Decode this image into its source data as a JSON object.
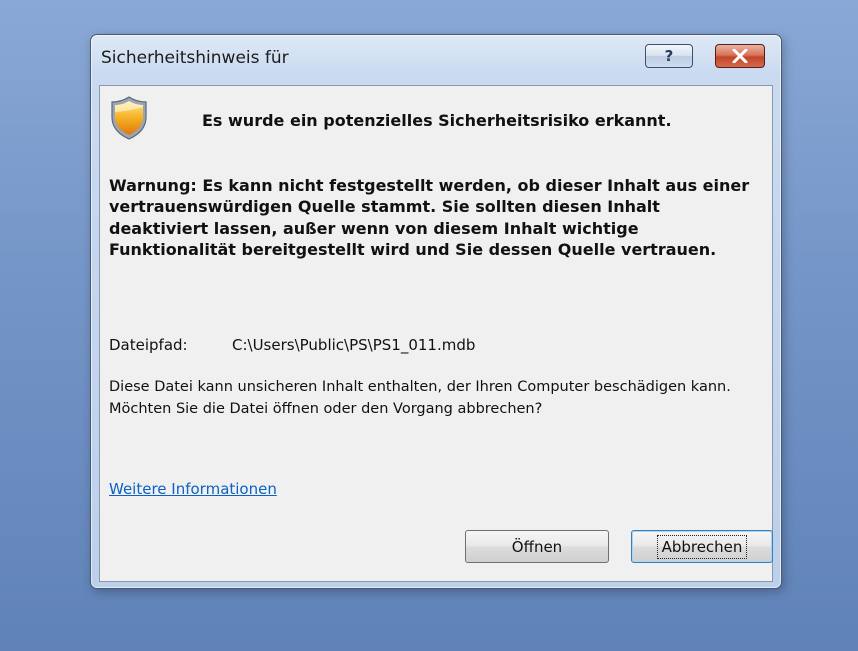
{
  "dialog": {
    "title": "Sicherheitshinweis für",
    "help_button_label": "?",
    "headline": "Es wurde ein potenzielles Sicherheitsrisiko erkannt.",
    "warning_text": "Warnung: Es kann nicht festgestellt werden, ob dieser Inhalt aus einer vertrauenswürdigen Quelle stammt. Sie sollten diesen Inhalt deaktiviert lassen, außer wenn von diesem Inhalt wichtige Funktionalität bereitgestellt wird und Sie dessen Quelle vertrauen.",
    "filepath_label": "Dateipfad:",
    "filepath_value": "C:\\Users\\Public\\PS\\PS1_011.mdb",
    "body_text": "Diese Datei kann unsicheren Inhalt enthalten, der Ihren Computer beschädigen kann. Möchten Sie die Datei öffnen oder den Vorgang abbrechen?",
    "more_info_link": "Weitere Informationen",
    "open_button": "Öffnen",
    "cancel_button": "Abbrechen"
  },
  "icons": {
    "shield": "security-shield-icon",
    "help": "help-icon",
    "close": "close-icon"
  },
  "colors": {
    "shield_fill": "#f3a21a",
    "link": "#0b62c4",
    "close_button": "#c4452a",
    "desktop": "#7596c8"
  }
}
